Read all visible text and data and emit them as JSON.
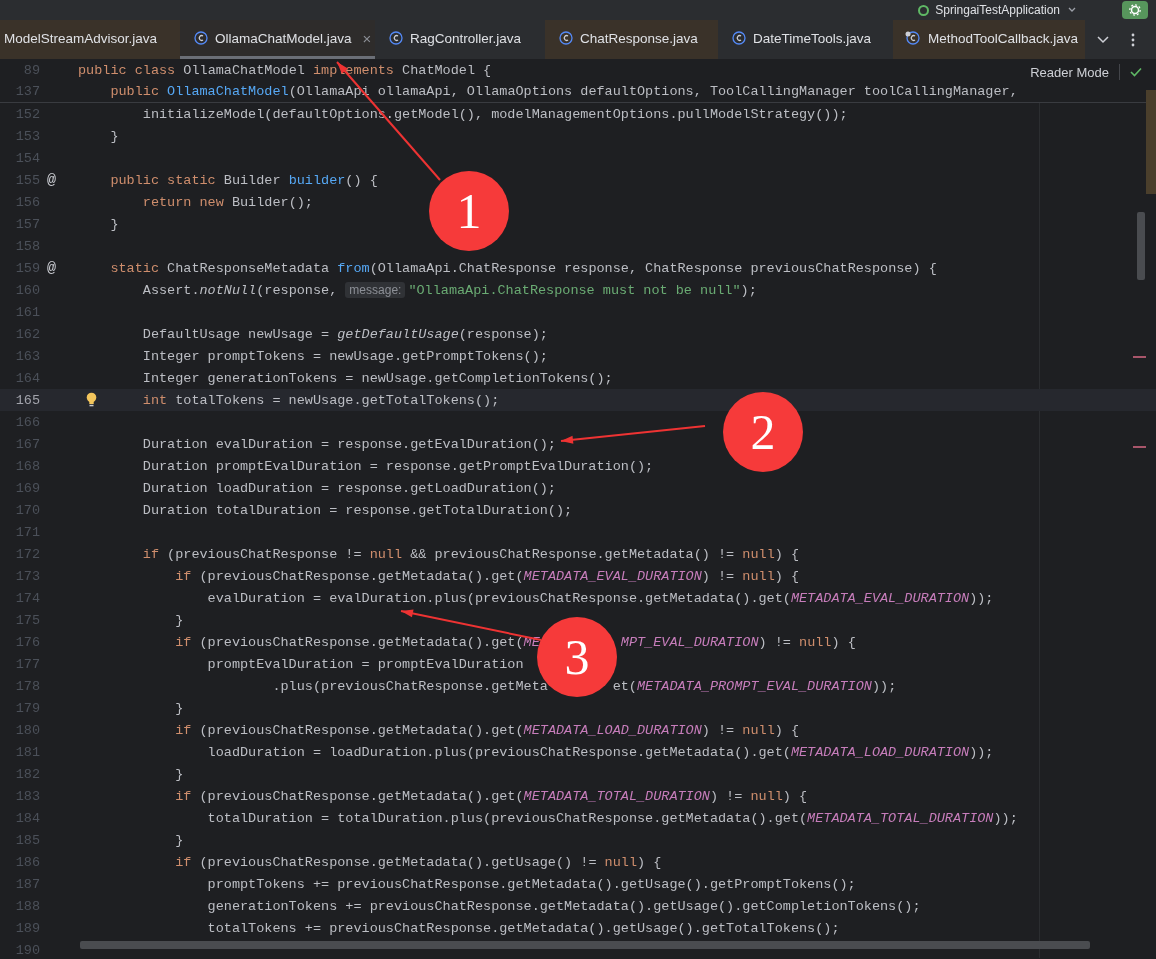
{
  "run_config": {
    "label": "SpringaiTestApplication"
  },
  "tabs": [
    {
      "label": "ModelStreamAdvisor.java",
      "selected": false,
      "color": "#3a3229",
      "kind": "plain"
    },
    {
      "label": "OllamaChatModel.java",
      "selected": true,
      "color": "#2e2c2b",
      "kind": "class",
      "close": "×"
    },
    {
      "label": "RagController.java",
      "selected": false,
      "color": "#2b2d30",
      "kind": "class"
    },
    {
      "label": "ChatResponse.java",
      "selected": false,
      "color": "#3a3229",
      "kind": "class"
    },
    {
      "label": "DateTimeTools.java",
      "selected": false,
      "color": "#2b2d30",
      "kind": "class"
    },
    {
      "label": "MethodToolCallback.java",
      "selected": false,
      "color": "#3a3229",
      "kind": "badged-class"
    }
  ],
  "reader_mode": "Reader Mode",
  "sticky_lines": [
    {
      "number": "89",
      "tokens": [
        {
          "text": "public class ",
          "kind": "keyword"
        },
        {
          "text": "OllamaChatModel ",
          "kind": "plain"
        },
        {
          "text": "implements ",
          "kind": "keyword"
        },
        {
          "text": "ChatModel {",
          "kind": "plain"
        }
      ]
    },
    {
      "number": "137",
      "tokens": [
        {
          "text": "    public ",
          "kind": "keyword"
        },
        {
          "text": "OllamaChatModel",
          "kind": "declaration"
        },
        {
          "text": "(OllamaApi ollamaApi, OllamaOptions defaultOptions, ToolCallingManager toolCallingManager,",
          "kind": "plain"
        }
      ]
    }
  ],
  "lines": [
    {
      "number": "152",
      "current": false,
      "tokens": [
        {
          "text": "        initializeModel(defaultOptions.getModel(), modelManagementOptions.pullModelStrategy());",
          "kind": "plain"
        }
      ]
    },
    {
      "number": "153",
      "current": false,
      "tokens": [
        {
          "text": "    }",
          "kind": "plain"
        }
      ]
    },
    {
      "number": "154",
      "current": false
    },
    {
      "number": "155",
      "current": false,
      "gutter": {
        "kind": "text",
        "text": "@"
      },
      "tokens": [
        {
          "text": "    public static ",
          "kind": "keyword"
        },
        {
          "text": "Builder ",
          "kind": "plain"
        },
        {
          "text": "builder",
          "kind": "declaration"
        },
        {
          "text": "() {",
          "kind": "plain"
        }
      ]
    },
    {
      "number": "156",
      "current": false,
      "tokens": [
        {
          "text": "        return new ",
          "kind": "keyword"
        },
        {
          "text": "Builder();",
          "kind": "plain"
        }
      ]
    },
    {
      "number": "157",
      "current": false,
      "tokens": [
        {
          "text": "    }",
          "kind": "plain"
        }
      ]
    },
    {
      "number": "158",
      "current": false
    },
    {
      "number": "159",
      "current": false,
      "gutter": {
        "kind": "text",
        "text": "@"
      },
      "tokens": [
        {
          "text": "    static ",
          "kind": "keyword"
        },
        {
          "text": "ChatResponseMetadata ",
          "kind": "plain"
        },
        {
          "text": "from",
          "kind": "declaration"
        },
        {
          "text": "(OllamaApi.ChatResponse response, ChatResponse previousChatResponse) {",
          "kind": "plain"
        }
      ]
    },
    {
      "number": "160",
      "current": false,
      "tokens": [
        {
          "text": "        Assert.",
          "kind": "plain"
        },
        {
          "text": "notNull",
          "kind": "static-call"
        },
        {
          "text": "(response, ",
          "kind": "plain"
        },
        {
          "text": "message:",
          "kind": "hint"
        },
        {
          "text": "\"OllamaApi.ChatResponse must not be null\"",
          "kind": "string"
        },
        {
          "text": ");",
          "kind": "plain"
        }
      ]
    },
    {
      "number": "161",
      "current": false
    },
    {
      "number": "162",
      "current": false,
      "tokens": [
        {
          "text": "        DefaultUsage newUsage = ",
          "kind": "plain"
        },
        {
          "text": "getDefaultUsage",
          "kind": "static-call"
        },
        {
          "text": "(response);",
          "kind": "plain"
        }
      ]
    },
    {
      "number": "163",
      "current": false,
      "tokens": [
        {
          "text": "        Integer promptTokens = newUsage.getPromptTokens();",
          "kind": "plain"
        }
      ]
    },
    {
      "number": "164",
      "current": false,
      "tokens": [
        {
          "text": "        Integer generationTokens = newUsage.getCompletionTokens();",
          "kind": "plain"
        }
      ]
    },
    {
      "number": "165",
      "current": true,
      "gutter": {
        "kind": "bulb"
      },
      "tokens": [
        {
          "text": "        int ",
          "kind": "keyword"
        },
        {
          "text": "totalTokens = newUsage.getTotalTokens();",
          "kind": "plain"
        }
      ]
    },
    {
      "number": "166",
      "current": false
    },
    {
      "number": "167",
      "current": false,
      "tokens": [
        {
          "text": "        Duration evalDuration = response.getEvalDuration();",
          "kind": "plain"
        }
      ]
    },
    {
      "number": "168",
      "current": false,
      "tokens": [
        {
          "text": "        Duration promptEvalDuration = response.getPromptEvalDuration();",
          "kind": "plain"
        }
      ]
    },
    {
      "number": "169",
      "current": false,
      "tokens": [
        {
          "text": "        Duration loadDuration = response.getLoadDuration();",
          "kind": "plain"
        }
      ]
    },
    {
      "number": "170",
      "current": false,
      "tokens": [
        {
          "text": "        Duration totalDuration = response.getTotalDuration();",
          "kind": "plain"
        }
      ]
    },
    {
      "number": "171",
      "current": false
    },
    {
      "number": "172",
      "current": false,
      "tokens": [
        {
          "text": "        if ",
          "kind": "keyword"
        },
        {
          "text": "(previousChatResponse != ",
          "kind": "plain"
        },
        {
          "text": "null",
          "kind": "keyword"
        },
        {
          "text": " && previousChatResponse.getMetadata() != ",
          "kind": "plain"
        },
        {
          "text": "null",
          "kind": "keyword"
        },
        {
          "text": ") {",
          "kind": "plain"
        }
      ]
    },
    {
      "number": "173",
      "current": false,
      "tokens": [
        {
          "text": "            if ",
          "kind": "keyword"
        },
        {
          "text": "(previousChatResponse.getMetadata().get(",
          "kind": "plain"
        },
        {
          "text": "METADATA_EVAL_DURATION",
          "kind": "constant"
        },
        {
          "text": ") != ",
          "kind": "plain"
        },
        {
          "text": "null",
          "kind": "keyword"
        },
        {
          "text": ") {",
          "kind": "plain"
        }
      ]
    },
    {
      "number": "174",
      "current": false,
      "tokens": [
        {
          "text": "                evalDuration = evalDuration.plus(previousChatResponse.getMetadata().get(",
          "kind": "plain"
        },
        {
          "text": "METADATA_EVAL_DURATION",
          "kind": "constant"
        },
        {
          "text": "));",
          "kind": "plain"
        }
      ]
    },
    {
      "number": "175",
      "current": false,
      "tokens": [
        {
          "text": "            }",
          "kind": "plain"
        }
      ]
    },
    {
      "number": "176",
      "current": false,
      "tokens": [
        {
          "text": "            if ",
          "kind": "keyword"
        },
        {
          "text": "(previousChatResponse.getMetadata().get(",
          "kind": "plain"
        },
        {
          "text": "ME",
          "kind": "constant"
        }
      ],
      "tokens_after_cover": [
        {
          "text": "MPT_EVAL_DURATION",
          "kind": "constant"
        },
        {
          "text": ") != ",
          "kind": "plain"
        },
        {
          "text": "null",
          "kind": "keyword"
        },
        {
          "text": ") {",
          "kind": "plain"
        }
      ]
    },
    {
      "number": "177",
      "current": false,
      "tokens": [
        {
          "text": "                promptEvalDuration = promptEvalDuration",
          "kind": "plain"
        }
      ]
    },
    {
      "number": "178",
      "current": false,
      "tokens": [
        {
          "text": "                        .plus(previousChatResponse.getMeta",
          "kind": "plain"
        }
      ],
      "tokens_after_cover": [
        {
          "text": "et(",
          "kind": "plain"
        },
        {
          "text": "METADATA_PROMPT_EVAL_DURATION",
          "kind": "constant"
        },
        {
          "text": "));",
          "kind": "plain"
        }
      ]
    },
    {
      "number": "179",
      "current": false,
      "tokens": [
        {
          "text": "            }",
          "kind": "plain"
        }
      ]
    },
    {
      "number": "180",
      "current": false,
      "tokens": [
        {
          "text": "            if ",
          "kind": "keyword"
        },
        {
          "text": "(previousChatResponse.getMetadata().get(",
          "kind": "plain"
        },
        {
          "text": "METADATA_LOAD_DURATION",
          "kind": "constant"
        },
        {
          "text": ") != ",
          "kind": "plain"
        },
        {
          "text": "null",
          "kind": "keyword"
        },
        {
          "text": ") {",
          "kind": "plain"
        }
      ]
    },
    {
      "number": "181",
      "current": false,
      "tokens": [
        {
          "text": "                loadDuration = loadDuration.plus(previousChatResponse.getMetadata().get(",
          "kind": "plain"
        },
        {
          "text": "METADATA_LOAD_DURATION",
          "kind": "constant"
        },
        {
          "text": "));",
          "kind": "plain"
        }
      ]
    },
    {
      "number": "182",
      "current": false,
      "tokens": [
        {
          "text": "            }",
          "kind": "plain"
        }
      ]
    },
    {
      "number": "183",
      "current": false,
      "tokens": [
        {
          "text": "            if ",
          "kind": "keyword"
        },
        {
          "text": "(previousChatResponse.getMetadata().get(",
          "kind": "plain"
        },
        {
          "text": "METADATA_TOTAL_DURATION",
          "kind": "constant"
        },
        {
          "text": ") != ",
          "kind": "plain"
        },
        {
          "text": "null",
          "kind": "keyword"
        },
        {
          "text": ") {",
          "kind": "plain"
        }
      ]
    },
    {
      "number": "184",
      "current": false,
      "tokens": [
        {
          "text": "                totalDuration = totalDuration.plus(previousChatResponse.getMetadata().get(",
          "kind": "plain"
        },
        {
          "text": "METADATA_TOTAL_DURATION",
          "kind": "constant"
        },
        {
          "text": "));",
          "kind": "plain"
        }
      ]
    },
    {
      "number": "185",
      "current": false,
      "tokens": [
        {
          "text": "            }",
          "kind": "plain"
        }
      ]
    },
    {
      "number": "186",
      "current": false,
      "tokens": [
        {
          "text": "            if ",
          "kind": "keyword"
        },
        {
          "text": "(previousChatResponse.getMetadata().getUsage() != ",
          "kind": "plain"
        },
        {
          "text": "null",
          "kind": "keyword"
        },
        {
          "text": ") {",
          "kind": "plain"
        }
      ]
    },
    {
      "number": "187",
      "current": false,
      "tokens": [
        {
          "text": "                promptTokens += previousChatResponse.getMetadata().getUsage().getPromptTokens();",
          "kind": "plain"
        }
      ]
    },
    {
      "number": "188",
      "current": false,
      "tokens": [
        {
          "text": "                generationTokens += previousChatResponse.getMetadata().getUsage().getCompletionTokens();",
          "kind": "plain"
        }
      ]
    },
    {
      "number": "189",
      "current": false,
      "tokens": [
        {
          "text": "                totalTokens += previousChatResponse.getMetadata().getUsage().getTotalTokens();",
          "kind": "plain"
        }
      ]
    },
    {
      "number": "190",
      "current": false
    }
  ],
  "annotations": [
    {
      "number": "1"
    },
    {
      "number": "2"
    },
    {
      "number": "3"
    }
  ]
}
